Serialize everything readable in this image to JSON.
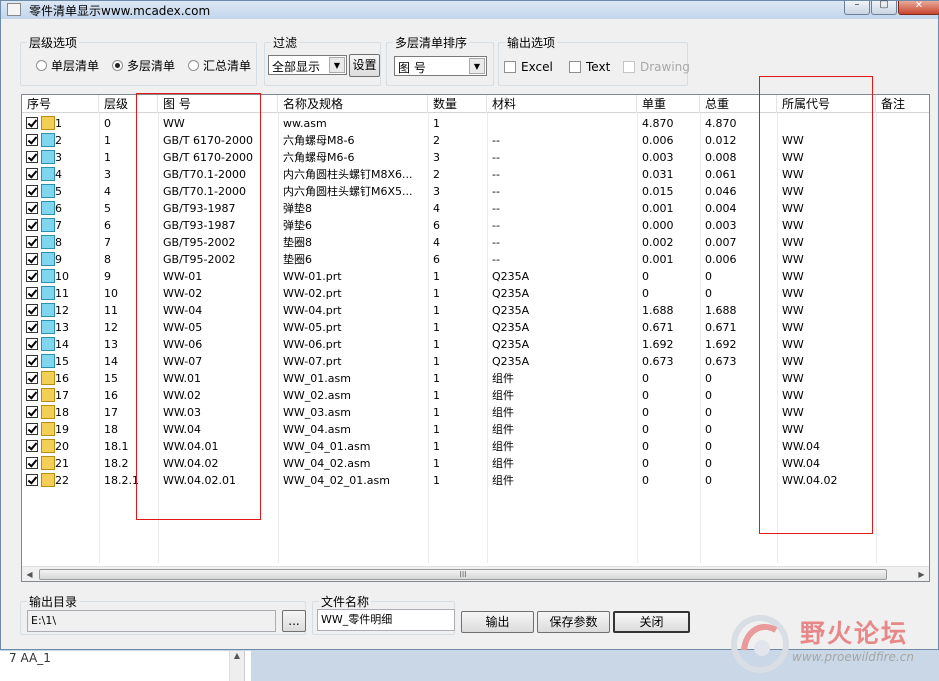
{
  "window": {
    "title": "零件清单显示www.mcadex.com"
  },
  "level_options": {
    "legend": "层级选项",
    "options": [
      "单层清单",
      "多层清单",
      "汇总清单"
    ],
    "selected_index": 1
  },
  "filter": {
    "legend": "过滤",
    "value": "全部显示",
    "settings_label": "设置"
  },
  "sort": {
    "legend": "多层清单排序",
    "value": "图  号"
  },
  "output_options": {
    "legend": "输出选项",
    "items": [
      {
        "label": "Excel",
        "checked": false,
        "enabled": true
      },
      {
        "label": "Text",
        "checked": false,
        "enabled": true
      },
      {
        "label": "Drawing",
        "checked": false,
        "enabled": false
      }
    ]
  },
  "table": {
    "columns": [
      "序号",
      "层级",
      "图  号",
      "名称及规格",
      "数量",
      "材料",
      "单重",
      "总重",
      "所属代号",
      "备注"
    ],
    "rows": [
      {
        "seq": "1",
        "icon": "asm",
        "level": "0",
        "drawing": "WW",
        "name": "ww.asm",
        "qty": "1",
        "material": "",
        "unit_weight": "4.870",
        "total_weight": "4.870",
        "parent_code": "",
        "note": ""
      },
      {
        "seq": "2",
        "icon": "part",
        "level": "1",
        "drawing": "GB/T 6170-2000",
        "name": "六角螺母M8-6",
        "qty": "2",
        "material": "--",
        "unit_weight": "0.006",
        "total_weight": "0.012",
        "parent_code": "WW",
        "note": ""
      },
      {
        "seq": "3",
        "icon": "part",
        "level": "1",
        "drawing": "GB/T 6170-2000",
        "name": "六角螺母M6-6",
        "qty": "3",
        "material": "--",
        "unit_weight": "0.003",
        "total_weight": "0.008",
        "parent_code": "WW",
        "note": ""
      },
      {
        "seq": "4",
        "icon": "part",
        "level": "3",
        "drawing": "GB/T70.1-2000",
        "name": "内六角圆柱头螺钉M8X6...",
        "qty": "2",
        "material": "--",
        "unit_weight": "0.031",
        "total_weight": "0.061",
        "parent_code": "WW",
        "note": ""
      },
      {
        "seq": "5",
        "icon": "part",
        "level": "4",
        "drawing": "GB/T70.1-2000",
        "name": "内六角圆柱头螺钉M6X5...",
        "qty": "3",
        "material": "--",
        "unit_weight": "0.015",
        "total_weight": "0.046",
        "parent_code": "WW",
        "note": ""
      },
      {
        "seq": "6",
        "icon": "part",
        "level": "5",
        "drawing": "GB/T93-1987",
        "name": "弹垫8",
        "qty": "4",
        "material": "--",
        "unit_weight": "0.001",
        "total_weight": "0.004",
        "parent_code": "WW",
        "note": ""
      },
      {
        "seq": "7",
        "icon": "part",
        "level": "6",
        "drawing": "GB/T93-1987",
        "name": "弹垫6",
        "qty": "6",
        "material": "--",
        "unit_weight": "0.000",
        "total_weight": "0.003",
        "parent_code": "WW",
        "note": ""
      },
      {
        "seq": "8",
        "icon": "part",
        "level": "7",
        "drawing": "GB/T95-2002",
        "name": "垫圈8",
        "qty": "4",
        "material": "--",
        "unit_weight": "0.002",
        "total_weight": "0.007",
        "parent_code": "WW",
        "note": ""
      },
      {
        "seq": "9",
        "icon": "part",
        "level": "8",
        "drawing": "GB/T95-2002",
        "name": "垫圈6",
        "qty": "6",
        "material": "--",
        "unit_weight": "0.001",
        "total_weight": "0.006",
        "parent_code": "WW",
        "note": ""
      },
      {
        "seq": "10",
        "icon": "part",
        "level": "9",
        "drawing": "WW-01",
        "name": "WW-01.prt",
        "qty": "1",
        "material": "Q235A",
        "unit_weight": "0",
        "total_weight": "0",
        "parent_code": "WW",
        "note": ""
      },
      {
        "seq": "11",
        "icon": "part",
        "level": "10",
        "drawing": "WW-02",
        "name": "WW-02.prt",
        "qty": "1",
        "material": "Q235A",
        "unit_weight": "0",
        "total_weight": "0",
        "parent_code": "WW",
        "note": ""
      },
      {
        "seq": "12",
        "icon": "part",
        "level": "11",
        "drawing": "WW-04",
        "name": "WW-04.prt",
        "qty": "1",
        "material": "Q235A",
        "unit_weight": "1.688",
        "total_weight": "1.688",
        "parent_code": "WW",
        "note": ""
      },
      {
        "seq": "13",
        "icon": "part",
        "level": "12",
        "drawing": "WW-05",
        "name": "WW-05.prt",
        "qty": "1",
        "material": "Q235A",
        "unit_weight": "0.671",
        "total_weight": "0.671",
        "parent_code": "WW",
        "note": ""
      },
      {
        "seq": "14",
        "icon": "part",
        "level": "13",
        "drawing": "WW-06",
        "name": "WW-06.prt",
        "qty": "1",
        "material": "Q235A",
        "unit_weight": "1.692",
        "total_weight": "1.692",
        "parent_code": "WW",
        "note": ""
      },
      {
        "seq": "15",
        "icon": "part",
        "level": "14",
        "drawing": "WW-07",
        "name": "WW-07.prt",
        "qty": "1",
        "material": "Q235A",
        "unit_weight": "0.673",
        "total_weight": "0.673",
        "parent_code": "WW",
        "note": ""
      },
      {
        "seq": "16",
        "icon": "asm",
        "level": "15",
        "drawing": "WW.01",
        "name": "WW_01.asm",
        "qty": "1",
        "material": "组件",
        "unit_weight": "0",
        "total_weight": "0",
        "parent_code": "WW",
        "note": ""
      },
      {
        "seq": "17",
        "icon": "asm",
        "level": "16",
        "drawing": "WW.02",
        "name": "WW_02.asm",
        "qty": "1",
        "material": "组件",
        "unit_weight": "0",
        "total_weight": "0",
        "parent_code": "WW",
        "note": ""
      },
      {
        "seq": "18",
        "icon": "asm",
        "level": "17",
        "drawing": "WW.03",
        "name": "WW_03.asm",
        "qty": "1",
        "material": "组件",
        "unit_weight": "0",
        "total_weight": "0",
        "parent_code": "WW",
        "note": ""
      },
      {
        "seq": "19",
        "icon": "asm",
        "level": "18",
        "drawing": "WW.04",
        "name": "WW_04.asm",
        "qty": "1",
        "material": "组件",
        "unit_weight": "0",
        "total_weight": "0",
        "parent_code": "WW",
        "note": ""
      },
      {
        "seq": "20",
        "icon": "asm",
        "level": "18.1",
        "drawing": "WW.04.01",
        "name": "WW_04_01.asm",
        "qty": "1",
        "material": "组件",
        "unit_weight": "0",
        "total_weight": "0",
        "parent_code": "WW.04",
        "note": ""
      },
      {
        "seq": "21",
        "icon": "asm",
        "level": "18.2",
        "drawing": "WW.04.02",
        "name": "WW_04_02.asm",
        "qty": "1",
        "material": "组件",
        "unit_weight": "0",
        "total_weight": "0",
        "parent_code": "WW.04",
        "note": ""
      },
      {
        "seq": "22",
        "icon": "asm",
        "level": "18.2.1",
        "drawing": "WW.04.02.01",
        "name": "WW_04_02_01.asm",
        "qty": "1",
        "material": "组件",
        "unit_weight": "0",
        "total_weight": "0",
        "parent_code": "WW.04.02",
        "note": ""
      }
    ],
    "scroll_grip": "III"
  },
  "output_dir": {
    "legend": "输出目录",
    "value": "E:\\1\\",
    "browse_label": "..."
  },
  "file_name": {
    "legend": "文件名称",
    "value": "WW_零件明细"
  },
  "buttons": {
    "export": "输出",
    "save_params": "保存参数",
    "close": "关闭"
  },
  "background": {
    "tree_item": "7  AA_1"
  },
  "watermark": {
    "title": "野火论坛",
    "url": "www.proewildfire.cn"
  },
  "colors": {
    "highlight_box": "#e01818",
    "part_icon": "#7fd6ee",
    "assembly_icon": "#f3cf57"
  }
}
